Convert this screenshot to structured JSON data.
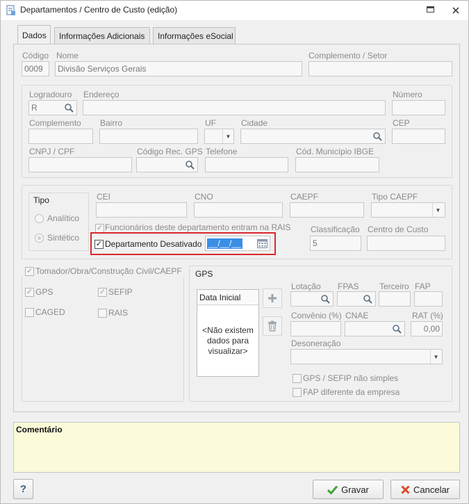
{
  "window": {
    "title": "Departamentos / Centro de Custo (edição)"
  },
  "tabs": [
    {
      "label": "Dados"
    },
    {
      "label": "Informações Adicionais"
    },
    {
      "label": "Informações eSocial"
    }
  ],
  "main": {
    "codigo_label": "Código",
    "codigo_value": "0009",
    "nome_label": "Nome",
    "nome_value": "Divisão Serviços Gerais",
    "complemento_setor_label": "Complemento / Setor",
    "complemento_setor_value": ""
  },
  "address": {
    "logradouro_label": "Logradouro",
    "logradouro_value": "R",
    "endereco_label": "Endereço",
    "numero_label": "Número",
    "complemento_label": "Complemento",
    "bairro_label": "Bairro",
    "uf_label": "UF",
    "cidade_label": "Cidade",
    "cep_label": "CEP",
    "cnpj_label": "CNPJ / CPF",
    "cod_rec_gps_label": "Código Rec. GPS",
    "telefone_label": "Telefone",
    "cod_municipio_label": "Cód. Município IBGE"
  },
  "tipo": {
    "title": "Tipo",
    "option_analitico": "Analítico",
    "option_sintetico": "Sintético",
    "cei_label": "CEI",
    "cno_label": "CNO",
    "caepf_label": "CAEPF",
    "tipo_caepf_label": "Tipo CAEPF",
    "funcionarios_rais_label": "Funcionários deste departamento entram na RAIS",
    "desativado_label": "Departamento Desativado",
    "desativado_date": "__/__/__",
    "classificacao_label": "Classificação",
    "classificacao_value": "5",
    "centro_custo_label": "Centro de Custo"
  },
  "flags": {
    "tomador_label": "Tomador/Obra/Construção Civil/CAEPF",
    "gps_label": "GPS",
    "sefip_label": "SEFIP",
    "caged_label": "CAGED",
    "rais_label": "RAIS"
  },
  "gps": {
    "title": "GPS",
    "list_header": "Data Inicial",
    "empty_text": "<Não existem dados para visualizar>",
    "lotacao_label": "Lotação",
    "fpas_label": "FPAS",
    "terceiro_label": "Terceiro",
    "fap_label": "FAP",
    "convenio_label": "Convênio (%)",
    "cnae_label": "CNAE",
    "rat_label": "RAT (%)",
    "rat_value": "0,00",
    "desoneracao_label": "Desoneração",
    "gps_sefip_label": "GPS / SEFIP não simples",
    "fap_diferente_label": "FAP diferente da empresa"
  },
  "comentario": {
    "label": "Comentário"
  },
  "footer": {
    "help_label": "?",
    "gravar_label": "Gravar",
    "cancelar_label": "Cancelar"
  },
  "colors": {
    "highlight_border": "#d9272e",
    "comment_bg": "#fbfbd9",
    "date_selection": "#3a8ee6",
    "gravar_check": "#3fa535",
    "cancelar_x": "#d94a2c"
  }
}
